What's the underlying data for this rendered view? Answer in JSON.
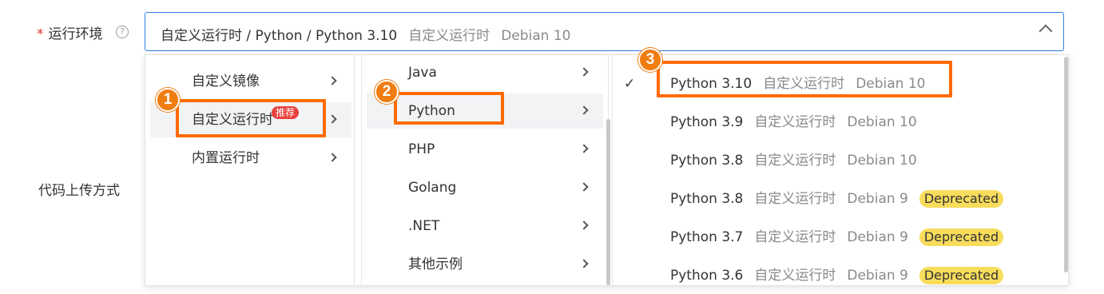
{
  "form": {
    "runtime_label": "运行环境",
    "runtime_required_mark": "*",
    "help_icon": "help-circle-icon",
    "help_glyph": "?",
    "upload_label": "代码上传方式"
  },
  "select": {
    "value_main": "自定义运行时 / Python /  Python 3.10",
    "value_runtime": "自定义运行时",
    "value_os": "Debian 10",
    "chevron_icon": "chevron-up-icon"
  },
  "cascader": {
    "level1": [
      {
        "label": "自定义镜像",
        "badge": ""
      },
      {
        "label": "自定义运行时",
        "badge": "推荐"
      },
      {
        "label": "内置运行时",
        "badge": ""
      }
    ],
    "level2": [
      {
        "label": "Java"
      },
      {
        "label": "Python"
      },
      {
        "label": "PHP"
      },
      {
        "label": "Golang"
      },
      {
        "label": ".NET"
      },
      {
        "label": "其他示例"
      }
    ],
    "level3": [
      {
        "name": "Python 3.10",
        "runtime": "自定义运行时",
        "os": "Debian 10",
        "tag": "",
        "selected": true
      },
      {
        "name": "Python 3.9",
        "runtime": "自定义运行时",
        "os": "Debian 10",
        "tag": "",
        "selected": false
      },
      {
        "name": "Python 3.8",
        "runtime": "自定义运行时",
        "os": "Debian 10",
        "tag": "",
        "selected": false
      },
      {
        "name": "Python 3.8",
        "runtime": "自定义运行时",
        "os": "Debian 9",
        "tag": "Deprecated",
        "selected": false
      },
      {
        "name": "Python 3.7",
        "runtime": "自定义运行时",
        "os": "Debian 9",
        "tag": "Deprecated",
        "selected": false
      },
      {
        "name": "Python 3.6",
        "runtime": "自定义运行时",
        "os": "Debian 9",
        "tag": "Deprecated",
        "selected": false
      }
    ],
    "check_glyph": "✓"
  },
  "annotations": {
    "step1": "1",
    "step2": "2",
    "step3": "3",
    "highlight_color": "#ff6a00"
  },
  "colors": {
    "accent": "#2f7de1",
    "recommend_badge": "#e8413b",
    "deprecated_badge": "#f8dc5b"
  }
}
